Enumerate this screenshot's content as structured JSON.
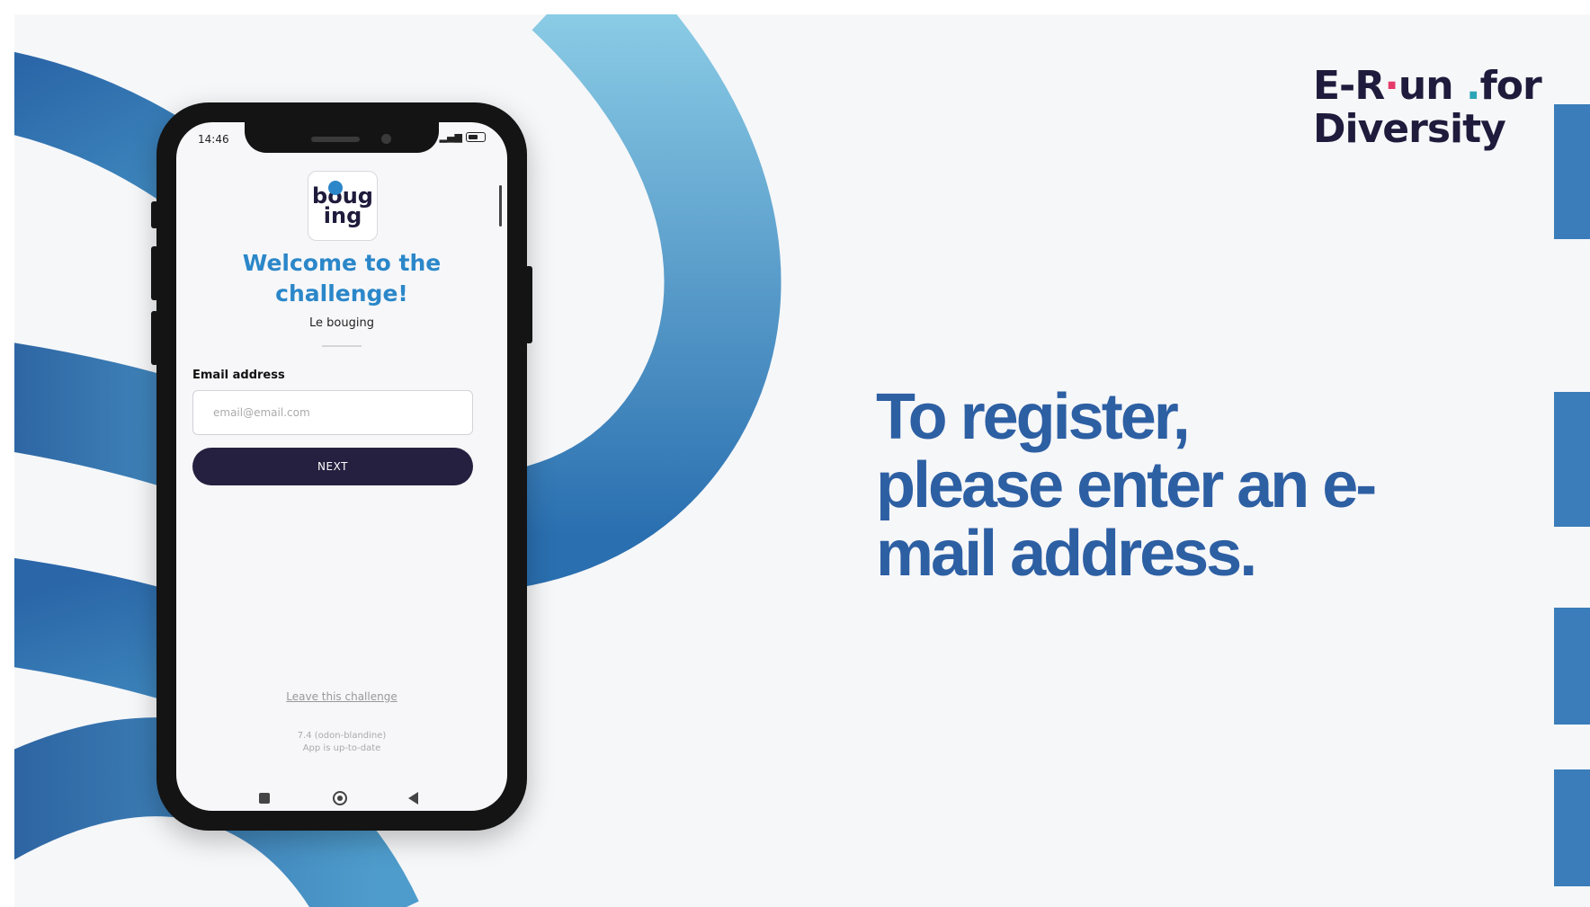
{
  "slide": {
    "brand": {
      "part1": "E-R",
      "dot_a": "·",
      "part2": "un ",
      "dot_b": ".",
      "part3": "for",
      "line2": "Diversity"
    },
    "headline": "To register, please enter an e-mail address."
  },
  "phone": {
    "status_time": "14:46",
    "app_logo_text": {
      "line1": "boug",
      "line2": "ing"
    },
    "welcome_title": "Welcome to the challenge!",
    "subtitle": "Le bouging",
    "email_label": "Email address",
    "email_placeholder": "email@email.com",
    "next_label": "NEXT",
    "leave_link": "Leave this challenge",
    "version_line1": "7.4 (odon-blandine)",
    "version_line2": "App is up-to-date"
  },
  "colors": {
    "ribbon_dark": "#2f74b1",
    "ribbon_light": "#8ecae6",
    "headline": "#2d5fa3",
    "welcome": "#2b87c9",
    "button": "#25203f",
    "brand_text": "#1f1b3c"
  }
}
